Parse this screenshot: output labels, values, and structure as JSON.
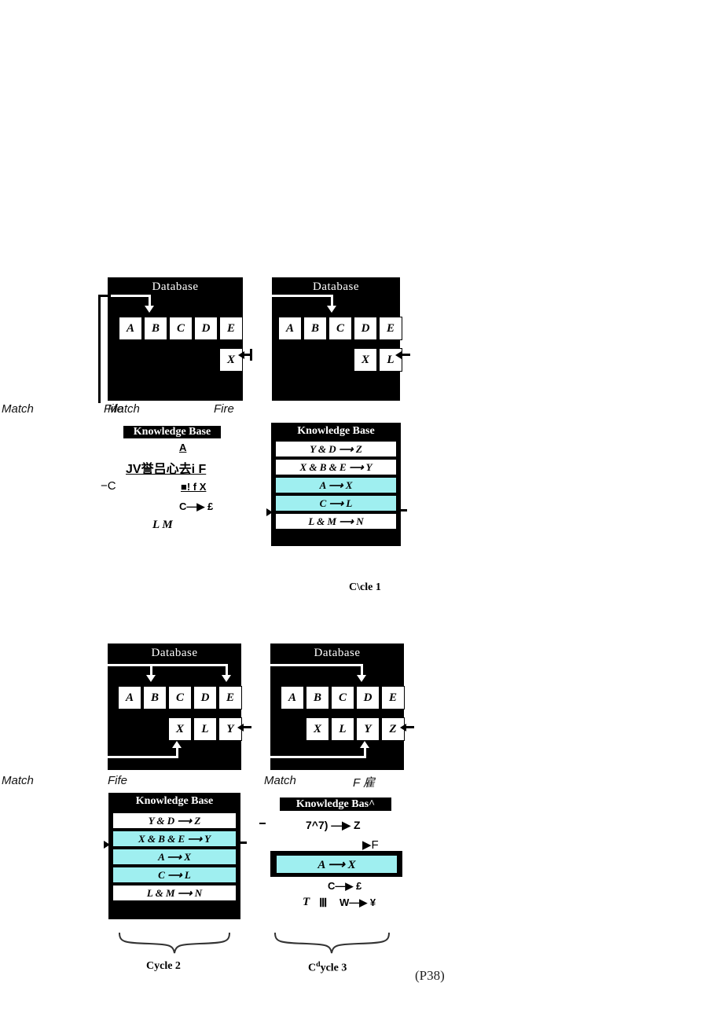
{
  "document": {
    "page_label": "(P38)",
    "figure_type": "rule-based expert system recognize-act cycle, four panels"
  },
  "labels": {
    "database_title": "Database",
    "knowledge_base_title": "Knowledge Base",
    "knowledge_base_title_degraded": "Knowledge Bas^",
    "match": "Match",
    "fire": "Fire",
    "match_overlap_artifact": "Match",
    "fire_overlap_artifact": "Fife",
    "fire_degraded_right": "F 雇"
  },
  "cycles": {
    "cycle1": "C\\cle 1",
    "cycle2": "Cycle 2",
    "cycle3_prefix": "C",
    "cycle3_sup": "d",
    "cycle3_rest": "ycle 3"
  },
  "panels": {
    "p1": {
      "name": "cycle-1-before",
      "database": {
        "row1": [
          "A",
          "B",
          "C",
          "D",
          "E"
        ],
        "row2": [
          "X"
        ],
        "arrow_down_target": "A",
        "arrow_in_right_target": "X"
      },
      "knowledge_base_degraded": {
        "title": "Knowledge Base",
        "line1": "A",
        "line2": "JV誉吕心去i F",
        "line3": "■! f X",
        "line4": "C—▶ £",
        "line5": "L M",
        "stray_left": "−C"
      }
    },
    "p2": {
      "name": "cycle-1-after",
      "database": {
        "row1": [
          "A",
          "B",
          "C",
          "D",
          "E"
        ],
        "row2": [
          "X",
          "L"
        ],
        "arrow_down_target": "C",
        "arrow_in_right_target": "L"
      },
      "knowledge_base": {
        "title": "Knowledge Base",
        "rules": [
          {
            "text": "Y & D ⟶ Z",
            "highlighted": false
          },
          {
            "text": "X & B & E ⟶ Y",
            "highlighted": false
          },
          {
            "text": "A ⟶ X",
            "highlighted": true
          },
          {
            "text": "C ⟶ L",
            "highlighted": true
          },
          {
            "text": "L & M ⟶ N",
            "highlighted": false
          }
        ]
      }
    },
    "p3": {
      "name": "cycle-2",
      "database": {
        "row1": [
          "A",
          "B",
          "C",
          "D",
          "E"
        ],
        "row2": [
          "X",
          "L",
          "Y"
        ],
        "arrow_down_targets": [
          "B",
          "E"
        ],
        "arrow_up_target": "X",
        "arrow_in_right_target": "Y"
      },
      "knowledge_base": {
        "title": "Knowledge Base",
        "rules": [
          {
            "text": "Y & D ⟶ Z",
            "highlighted": false
          },
          {
            "text": "X & B & E ⟶ Y",
            "highlighted": true
          },
          {
            "text": "A ⟶ X",
            "highlighted": true
          },
          {
            "text": "C ⟶ L",
            "highlighted": true
          },
          {
            "text": "L & M ⟶ N",
            "highlighted": false
          }
        ]
      }
    },
    "p4": {
      "name": "cycle-3",
      "database": {
        "row1": [
          "A",
          "B",
          "C",
          "D",
          "E"
        ],
        "row2": [
          "X",
          "L",
          "Y",
          "Z"
        ],
        "arrow_down_target": "D",
        "arrow_up_target": "Y",
        "arrow_in_right_target": "Z"
      },
      "knowledge_base_degraded": {
        "title": "Knowledge Bas^",
        "line1": "7^7) —▶ Z",
        "line2": "▶F",
        "highlighted_rule": "A ⟶ X",
        "line4": "C—▶ £",
        "line5_a": "T",
        "line5_b": "Ⅲ",
        "line5_c": "W—▶ ¥"
      }
    }
  },
  "colors": {
    "highlight": "#9FEFF0",
    "panel_bg": "#000000",
    "cell_bg": "#FFFFFF",
    "page_bg": "#FFFFFF"
  }
}
